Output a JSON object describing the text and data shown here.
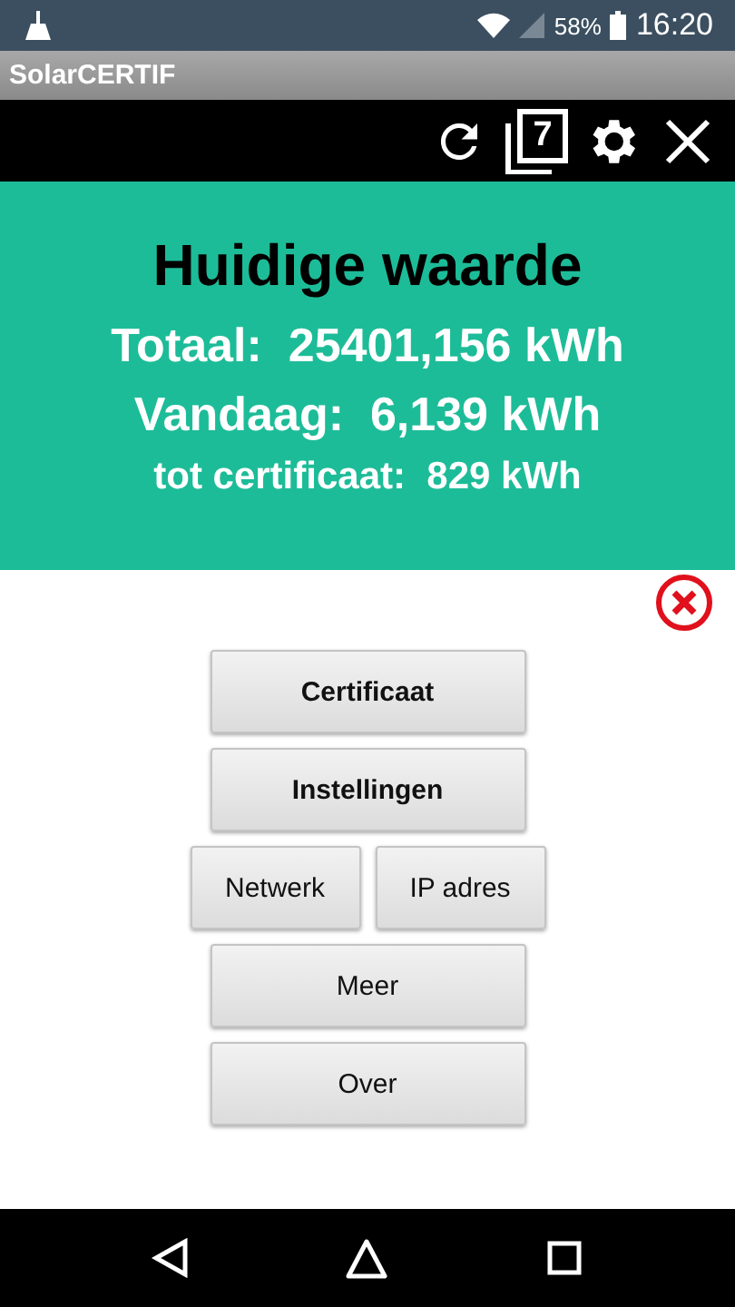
{
  "status_bar": {
    "battery": "58%",
    "time": "16:20"
  },
  "app_bar": {
    "title": "SolarCERTIF"
  },
  "toolbar": {
    "badge": "7"
  },
  "summary": {
    "heading": "Huidige waarde",
    "lines": [
      {
        "label": "Totaal:",
        "value": "25401,156 kWh",
        "kind": "large"
      },
      {
        "label": "Vandaag:",
        "value": "6,139 kWh",
        "kind": "large"
      },
      {
        "label": "tot certificaat:",
        "value": "829 kWh",
        "kind": "small"
      }
    ]
  },
  "menu": [
    [
      {
        "label": "Certificaat",
        "bold": true
      }
    ],
    [
      {
        "label": "Instellingen",
        "bold": true
      }
    ],
    [
      {
        "label": "Netwerk",
        "bold": false
      },
      {
        "label": "IP adres",
        "bold": false
      }
    ],
    [
      {
        "label": "Meer",
        "bold": false
      }
    ],
    [
      {
        "label": "Over",
        "bold": false
      }
    ]
  ]
}
